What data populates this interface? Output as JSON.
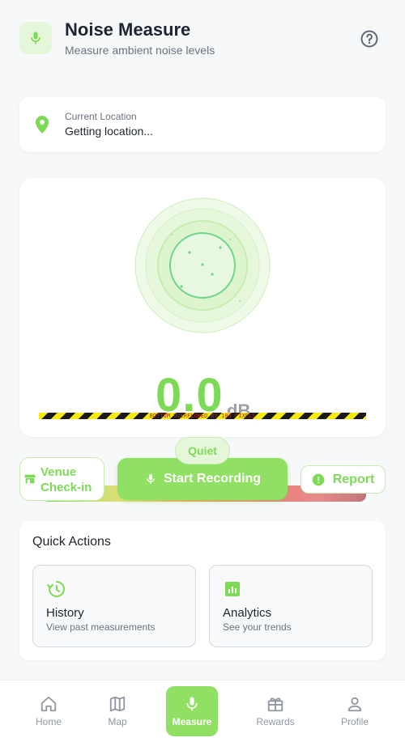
{
  "header": {
    "title": "Noise Measure",
    "subtitle": "Measure ambient noise levels",
    "app_icon": "microphone-icon",
    "help_icon": "help-circle-icon"
  },
  "location": {
    "label": "Current Location",
    "value": "Getting location...",
    "icon": "location-pin-icon"
  },
  "meter": {
    "value": "0.0",
    "unit": "dB",
    "overflow_message": "BOTTOM OVERFLOWED BY 103 PIXELS",
    "level_label": "Quiet"
  },
  "actions": {
    "venue_label": "Venue Check-in",
    "record_label": "Start Recording",
    "report_label": "Report"
  },
  "quick_actions": {
    "title": "Quick Actions",
    "items": [
      {
        "name": "History",
        "description": "View past measurements",
        "icon": "history-icon"
      },
      {
        "name": "Analytics",
        "description": "See your trends",
        "icon": "analytics-icon"
      }
    ]
  },
  "nav": {
    "items": [
      {
        "label": "Home",
        "icon": "home-icon"
      },
      {
        "label": "Map",
        "icon": "map-icon"
      },
      {
        "label": "Measure",
        "icon": "microphone-icon",
        "active": true
      },
      {
        "label": "Rewards",
        "icon": "gift-icon"
      },
      {
        "label": "Profile",
        "icon": "person-icon"
      }
    ]
  },
  "colors": {
    "accent": "#7ed957",
    "accent_button": "#8fe063",
    "accent_soft": "#e6f7d9",
    "text_primary": "#1f2430",
    "text_secondary": "#6b7280"
  }
}
